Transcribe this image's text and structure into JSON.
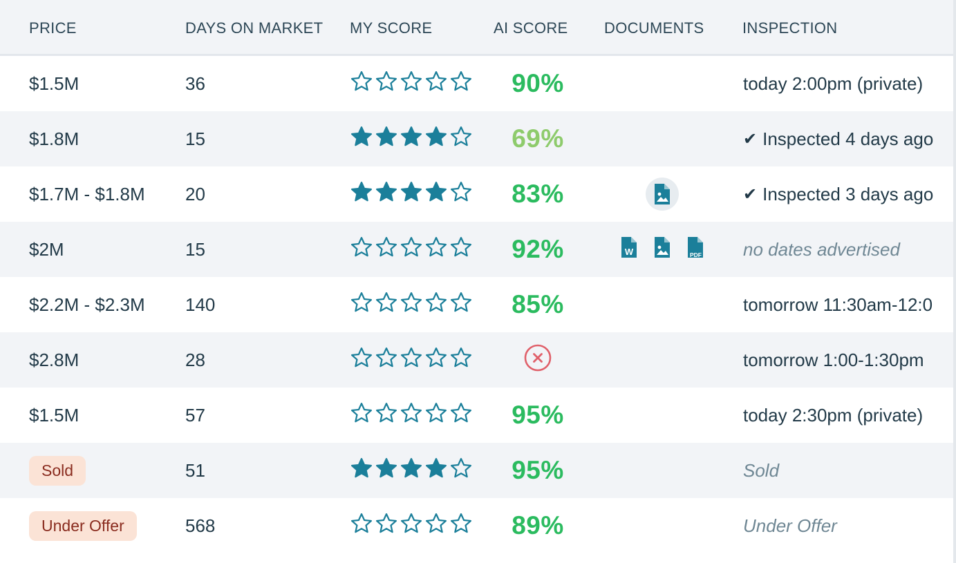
{
  "colors": {
    "star": "#1b7f9a",
    "ai_high": "#2bbb5f",
    "ai_mid": "#8ecb6c",
    "fail": "#e0606a",
    "badge_bg": "#fbe3d6",
    "badge_text": "#8a2c1f"
  },
  "columns": {
    "price": "PRICE",
    "days": "DAYS ON MARKET",
    "my_score": "MY SCORE",
    "ai_score": "AI SCORE",
    "documents": "DOCUMENTS",
    "inspection": "INSPECTION"
  },
  "rows": [
    {
      "price": "$1.5M",
      "price_badge": false,
      "days": "36",
      "my_score": 0,
      "ai_score": "90%",
      "ai_color": "#2bbb5f",
      "ai_failed": false,
      "documents": [],
      "docs_highlight": false,
      "inspection": "today 2:00pm (private)",
      "inspection_style": "normal"
    },
    {
      "price": "$1.8M",
      "price_badge": false,
      "days": "15",
      "my_score": 4,
      "ai_score": "69%",
      "ai_color": "#8ecb6c",
      "ai_failed": false,
      "documents": [],
      "docs_highlight": false,
      "inspection": "Inspected 4 days ago",
      "inspection_style": "check"
    },
    {
      "price": "$1.7M - $1.8M",
      "price_badge": false,
      "days": "20",
      "my_score": 4,
      "ai_score": "83%",
      "ai_color": "#2bbb5f",
      "ai_failed": false,
      "documents": [
        "image-file-icon"
      ],
      "docs_highlight": true,
      "inspection": "Inspected 3 days ago",
      "inspection_style": "check"
    },
    {
      "price": "$2M",
      "price_badge": false,
      "days": "15",
      "my_score": 0,
      "ai_score": "92%",
      "ai_color": "#2bbb5f",
      "ai_failed": false,
      "documents": [
        "word-file-icon",
        "image-file-icon",
        "pdf-file-icon"
      ],
      "docs_highlight": false,
      "inspection": "no dates advertised",
      "inspection_style": "italic"
    },
    {
      "price": "$2.2M - $2.3M",
      "price_badge": false,
      "days": "140",
      "my_score": 0,
      "ai_score": "85%",
      "ai_color": "#2bbb5f",
      "ai_failed": false,
      "documents": [],
      "docs_highlight": false,
      "inspection": "tomorrow 11:30am-12:0",
      "inspection_style": "normal"
    },
    {
      "price": "$2.8M",
      "price_badge": false,
      "days": "28",
      "my_score": 0,
      "ai_score": "",
      "ai_color": "#e0606a",
      "ai_failed": true,
      "documents": [],
      "docs_highlight": false,
      "inspection": "tomorrow 1:00-1:30pm",
      "inspection_style": "normal"
    },
    {
      "price": "$1.5M",
      "price_badge": false,
      "days": "57",
      "my_score": 0,
      "ai_score": "95%",
      "ai_color": "#2bbb5f",
      "ai_failed": false,
      "documents": [],
      "docs_highlight": false,
      "inspection": "today 2:30pm (private)",
      "inspection_style": "normal"
    },
    {
      "price": "Sold",
      "price_badge": true,
      "days": "51",
      "my_score": 4,
      "ai_score": "95%",
      "ai_color": "#2bbb5f",
      "ai_failed": false,
      "documents": [],
      "docs_highlight": false,
      "inspection": "Sold",
      "inspection_style": "italic"
    },
    {
      "price": "Under Offer",
      "price_badge": true,
      "days": "568",
      "my_score": 0,
      "ai_score": "89%",
      "ai_color": "#2bbb5f",
      "ai_failed": false,
      "documents": [],
      "docs_highlight": false,
      "inspection": "Under Offer",
      "inspection_style": "italic"
    }
  ],
  "document_labels": {
    "word": "W",
    "pdf": "PDF"
  }
}
